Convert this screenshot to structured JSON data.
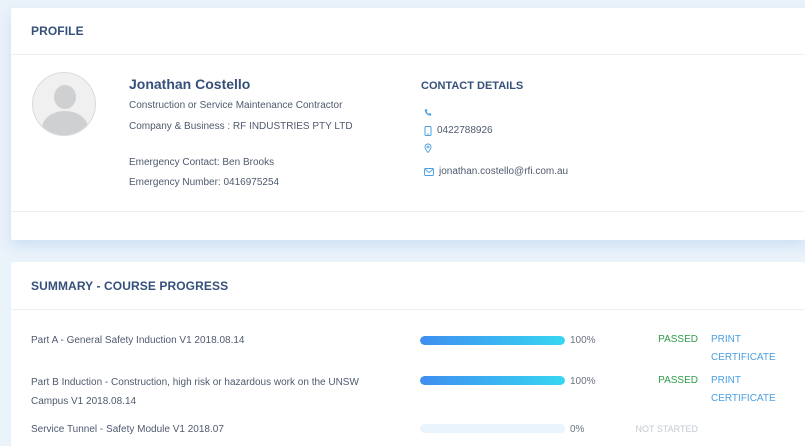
{
  "profile": {
    "header": "PROFILE",
    "name": "Jonathan Costello",
    "role": "Construction or Service Maintenance Contractor",
    "company": "Company & Business : RF INDUSTRIES PTY LTD",
    "emergency_contact": "Emergency Contact: Ben Brooks",
    "emergency_number": "Emergency Number: 0416975254"
  },
  "contact": {
    "title": "CONTACT DETAILS",
    "phone": "",
    "mobile": "0422788926",
    "address": "",
    "email": "jonathan.costello@rfi.com.au",
    "icons": [
      "phone-icon",
      "mobile-icon",
      "location-icon",
      "email-icon"
    ]
  },
  "progress": {
    "header": "SUMMARY - COURSE PROGRESS",
    "courses": [
      {
        "name": "Part A - General Safety Induction V1 2018.08.14",
        "percent": 100,
        "percent_label": "100%",
        "status": "PASSED",
        "print_label": "PRINT CERTIFICATE"
      },
      {
        "name": "Part B Induction - Construction, high risk or hazardous work on the UNSW Campus V1 2018.08.14",
        "percent": 100,
        "percent_label": "100%",
        "status": "PASSED",
        "print_label": "PRINT CERTIFICATE"
      },
      {
        "name": "Service Tunnel - Safety Module V1 2018.07",
        "percent": 0,
        "percent_label": "0%",
        "status": "NOT STARTED",
        "print_label": ""
      }
    ]
  },
  "colors": {
    "accent": "#35507a",
    "passed": "#2e9a4a",
    "link": "#4a9fe0",
    "bar_start": "#3f8ef0",
    "bar_end": "#38d6f3"
  }
}
